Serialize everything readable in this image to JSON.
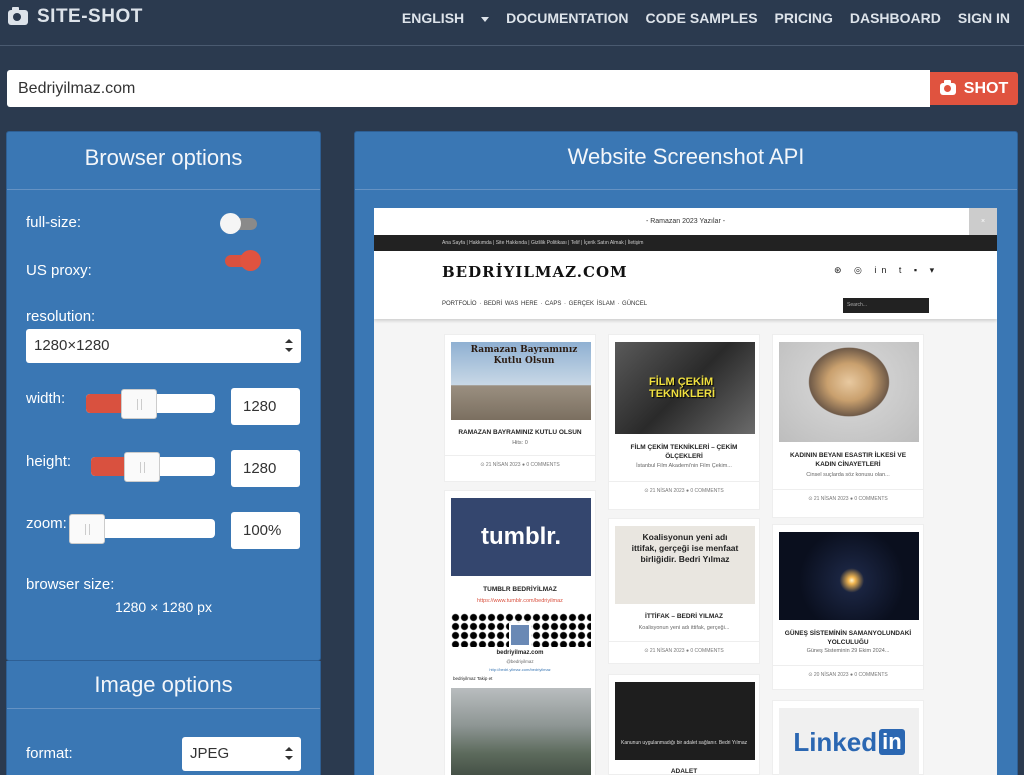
{
  "nav": {
    "brand": "SITE-SHOT",
    "items": [
      "ENGLISH",
      "DOCUMENTATION",
      "CODE SAMPLES",
      "PRICING",
      "DASHBOARD",
      "SIGN IN"
    ]
  },
  "url_input": {
    "value": "Bedriyilmaz.com"
  },
  "shot_button": {
    "label": "SHOT"
  },
  "browser_options": {
    "title": "Browser options",
    "full_size": {
      "label": "full-size:",
      "on": false
    },
    "us_proxy": {
      "label": "US proxy:",
      "on": true
    },
    "resolution": {
      "label": "resolution:",
      "value": "1280×1280"
    },
    "width": {
      "label": "width:",
      "value": "1280",
      "slider_fraction": 0.4
    },
    "height": {
      "label": "height:",
      "value": "1280",
      "slider_fraction": 0.4
    },
    "zoom": {
      "label": "zoom:",
      "value": "100%",
      "slider_fraction": 0.1
    },
    "browser_size": {
      "label": "browser size:",
      "value": "1280 × 1280 px"
    }
  },
  "image_options": {
    "title": "Image options",
    "format": {
      "label": "format:",
      "value": "JPEG"
    }
  },
  "preview_panel": {
    "title": "Website Screenshot API"
  },
  "preview": {
    "banner": "- Ramazan 2023 Yazılar -",
    "close": "×",
    "topbar": "Ana Sayfa  |  Hakkımda  |  Site Hakkında  |  Gizlilik Politikası  |  Telif  |  İçerik Satın Almak  |  İletişim",
    "logo": "BEDRİYILMAZ.COM",
    "social": "⊛ ◎ in t ▪ ▾",
    "menu": "PORTFOLİO   ·   BEDRİ WAS HERE   ·   CAPS   ·   GERÇEK İSLAM   ·   GÜNCEL",
    "search": "Search...",
    "cards": [
      {
        "img_text": "Ramazan Bayramınız Kutlu Olsun",
        "title": "RAMAZAN BAYRAMINIZ KUTLU OLSUN",
        "excerpt": "Hits: 0",
        "meta": "⊙ 21 NİSAN 2023   ● 0 COMMENTS"
      },
      {
        "img_text": "FİLM ÇEKİM TEKNİKLERİ",
        "title": "FİLM ÇEKİM TEKNİKLERİ – ÇEKİM ÖLÇEKLERİ",
        "excerpt": "İstanbul Film Akademi'nin Film Çekim...",
        "meta": "⊙ 21 NİSAN 2023   ● 0 COMMENTS"
      },
      {
        "img_text": "",
        "title": "KADININ BEYANI ESASTIR İLKESİ VE KADIN CİNAYETLERİ",
        "excerpt": "Cinsel suçlarda söz konusu olan...",
        "meta": "⊙ 21 NİSAN 2023   ● 0 COMMENTS"
      },
      {
        "img_text": "tumblr.",
        "title": "TUMBLR BEDRİYİLMAZ",
        "excerpt": "https://www.tumblr.com/bedriyilmaz",
        "meta": ""
      },
      {
        "img_text": "Koalisyonun yeni adı ittifak, gerçeği ise menfaat birliğidir. Bedri Yılmaz",
        "title": "İTTİFAK – BEDRİ YILMAZ",
        "excerpt": "Koalisyonun yeni adı ittifak, gerçeği...",
        "meta": "⊙ 21 NİSAN 2023   ● 0 COMMENTS"
      },
      {
        "img_text": "",
        "title": "GÜNEŞ SİSTEMİNİN SAMANYOLUNDAKİ YOLCULUĞU",
        "excerpt": "Güneş Sisteminin 29 Ekim 2024...",
        "meta": "⊙ 20 NİSAN 2023   ● 0 COMMENTS"
      },
      {
        "img_text": "Kanunun uygulanmadığı bir adalet sağlanır.   Bedri Yılmaz",
        "title": "ADALET",
        "excerpt": "",
        "meta": ""
      },
      {
        "img_text": "Linked",
        "title": "",
        "excerpt": "",
        "meta": ""
      }
    ],
    "profile": {
      "name": "bedriyilmaz.com",
      "handle": "@bedriyilmaz",
      "link": "http://bedri.yilmaz.com/bedriyilmaz",
      "row": "bedriyilmaz   Takip et"
    }
  },
  "colors": {
    "accent": "#e0533f",
    "panel": "#3a77b4",
    "bg": "#2b3a4f"
  }
}
